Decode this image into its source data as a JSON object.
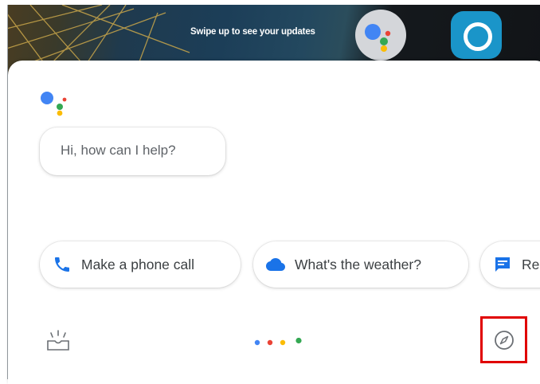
{
  "background": {
    "swipe_hint": "Swipe up to see your updates",
    "apps": [
      "google-assistant-app-icon",
      "alexa-app-icon"
    ]
  },
  "assistant": {
    "greeting": "Hi, how can I help?",
    "logo_colors": [
      "#4285F4",
      "#EA4335",
      "#FBBC05",
      "#34A853"
    ]
  },
  "suggestions": [
    {
      "label": "Make a phone call",
      "icon": "phone-icon",
      "icon_color": "#1a73e8"
    },
    {
      "label": "What's the weather?",
      "icon": "cloud-icon",
      "icon_color": "#1a73e8"
    },
    {
      "label": "Re",
      "icon": "message-icon",
      "icon_color": "#1a73e8"
    }
  ],
  "bottom_bar": {
    "left_icon": "updates-tray-icon",
    "center": "listening-dots",
    "right_icon": "explore-compass-icon",
    "highlight_color": "#e00000"
  }
}
